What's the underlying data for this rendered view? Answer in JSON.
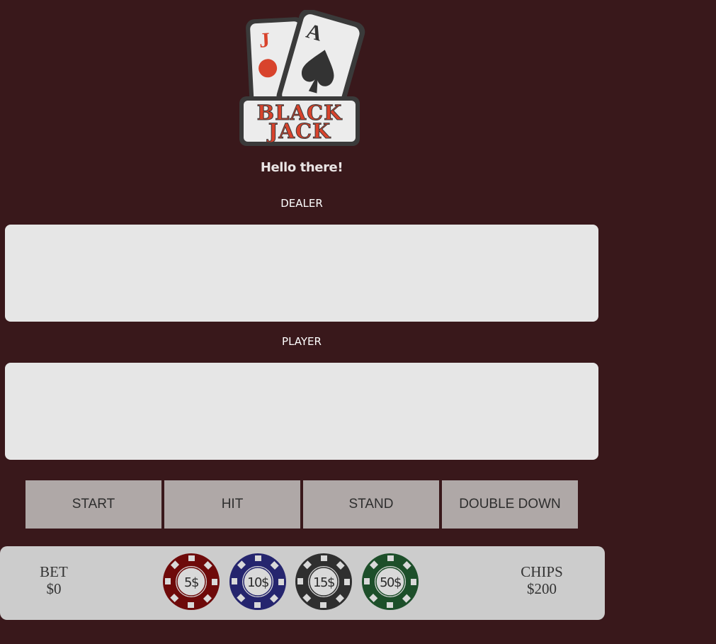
{
  "logo": {
    "card_back_rank": "J",
    "card_front_rank": "A",
    "line1": "BLACK",
    "line2": "JACK"
  },
  "greeting": "Hello there!",
  "dealer": {
    "label": "DEALER"
  },
  "player": {
    "label": "PLAYER"
  },
  "actions": {
    "start": "START",
    "hit": "HIT",
    "stand": "STAND",
    "double_down": "DOUBLE DOWN"
  },
  "tray": {
    "bet_label": "BET",
    "bet_value": "$0",
    "chips_label": "CHIPS",
    "chips_value": "$200",
    "chips": [
      {
        "label": "5$",
        "color": "#6e0a0a"
      },
      {
        "label": "10$",
        "color": "#25256e"
      },
      {
        "label": "15$",
        "color": "#2f2f2f"
      },
      {
        "label": "50$",
        "color": "#1d4f2a"
      }
    ]
  },
  "colors": {
    "background": "#39181b",
    "hand_area": "#e6e6e6",
    "button": "#afa8a7",
    "tray": "#cccccc",
    "logo_red": "#d8432c"
  }
}
